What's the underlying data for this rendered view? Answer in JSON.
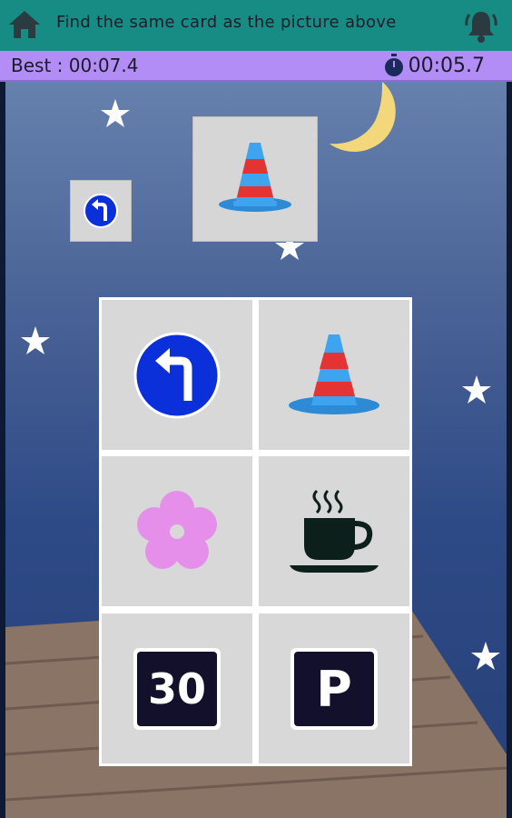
{
  "header": {
    "title": "Find the same card as the picture above",
    "home_icon": "home-icon",
    "bell_icon": "bell-icon",
    "bar_color": "#178c84"
  },
  "timer": {
    "best_label": "Best : 00:07.4",
    "current_time": "00:05.7",
    "stopwatch_icon": "stopwatch-icon",
    "bar_color": "#b28df5"
  },
  "targets": {
    "small_card": {
      "icon": "turn-left-sign-icon"
    },
    "large_card": {
      "icon": "traffic-cone-icon"
    }
  },
  "cards": [
    {
      "icon": "turn-left-sign-icon"
    },
    {
      "icon": "traffic-cone-icon"
    },
    {
      "icon": "flower-icon"
    },
    {
      "icon": "coffee-cup-icon"
    },
    {
      "icon": "speed-limit-sign-icon",
      "text": "30"
    },
    {
      "icon": "parking-sign-icon",
      "text": "P"
    }
  ]
}
